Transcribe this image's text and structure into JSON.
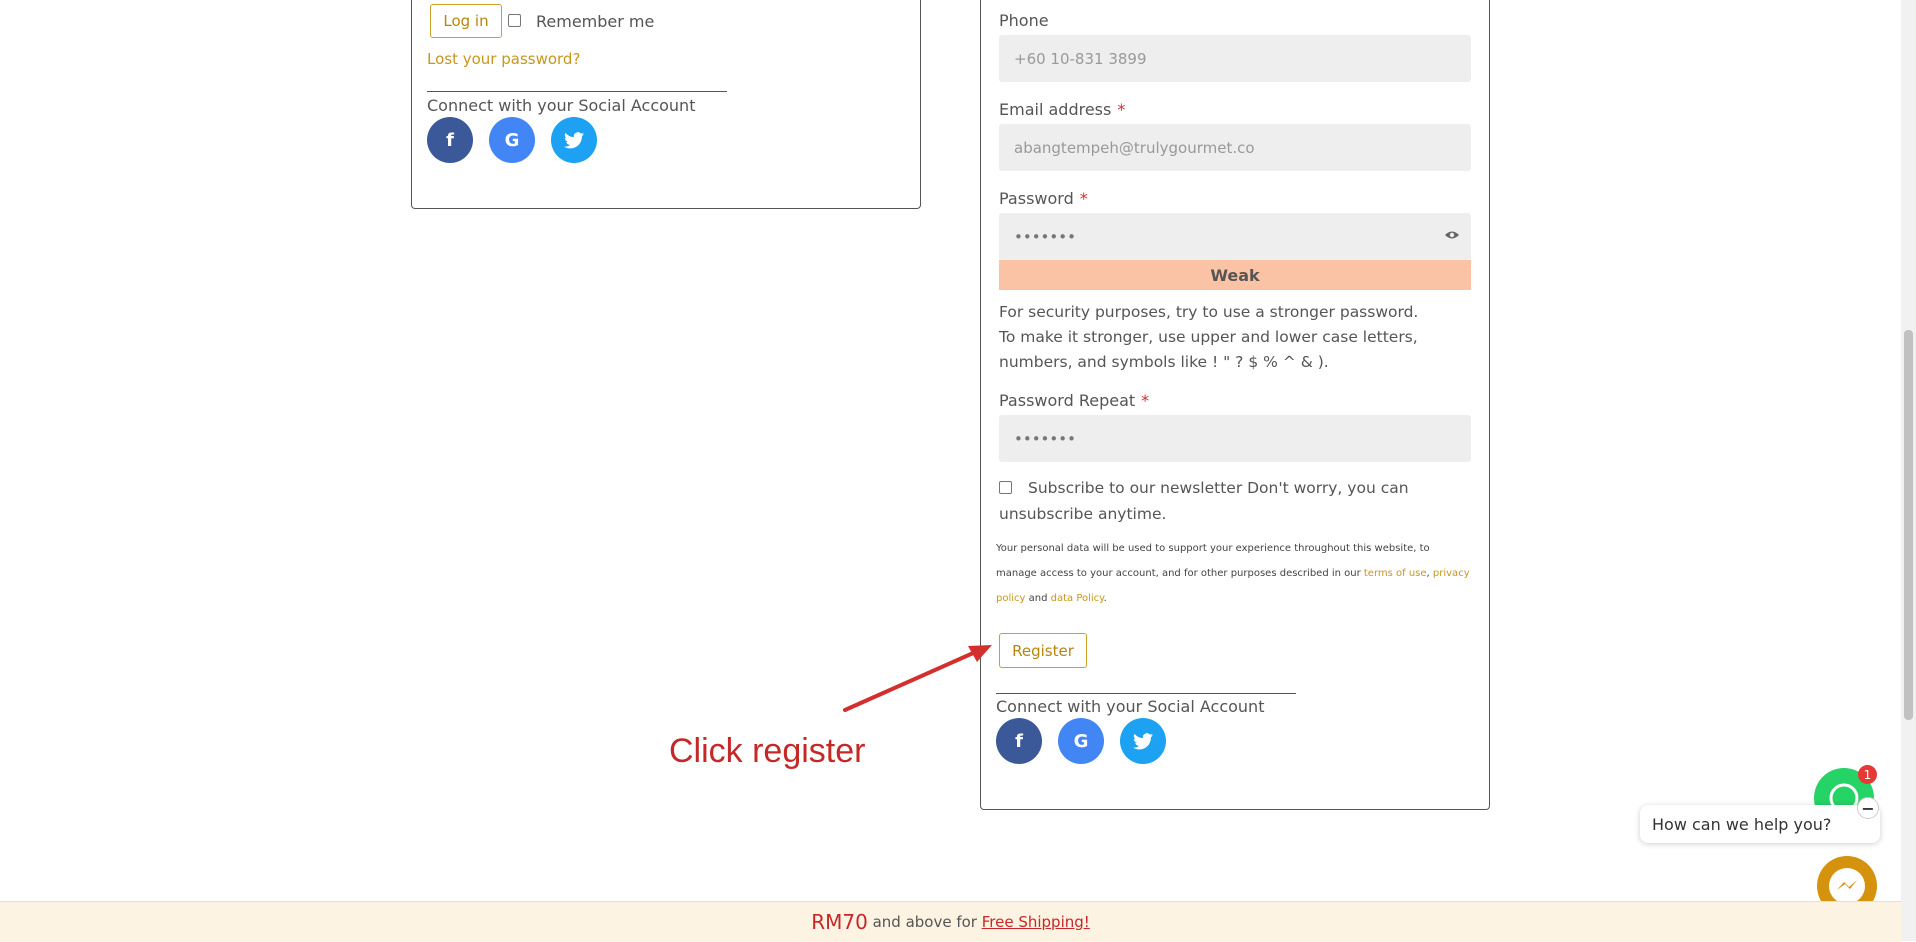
{
  "login": {
    "login_button": "Log in",
    "remember_me": "Remember me",
    "lost_password": "Lost your password?",
    "social_heading": "Connect with your Social Account"
  },
  "register": {
    "phone_label": "Phone",
    "phone_placeholder": "+60 10-831 3899",
    "email_label": "Email address",
    "email_value": "abangtempeh@trulygourmet.co",
    "password_label": "Password",
    "password_value": "•••••••",
    "strength": "Weak",
    "hint_line1": "For security purposes, try to use a stronger password.",
    "hint_line2": "To make it stronger, use upper and lower case letters,",
    "hint_line3": "numbers, and symbols like ! \" ? $ % ^ & ).",
    "password_repeat_label": "Password Repeat",
    "password_repeat_value": "•••••••",
    "required_mark": "*",
    "newsletter_line1": "Subscribe to our newsletter Don't worry, you can",
    "newsletter_line2": "unsubscribe anytime.",
    "privacy_line1": "Your personal data will be used to support your experience throughout this website, to",
    "privacy_line2_pre": "manage access to your account, and for other purposes described in our ",
    "privacy_terms": "terms of use",
    "privacy_comma": ", ",
    "privacy_policy_a": "privacy",
    "privacy_policy_b": "policy",
    "privacy_and": " and ",
    "privacy_data_policy": "data Policy",
    "privacy_end": ".",
    "register_button": "Register",
    "social_heading": "Connect with your Social Account"
  },
  "social": {
    "facebook": "f",
    "google": "G",
    "twitter": "t"
  },
  "annotation": {
    "text": "Click register"
  },
  "chat": {
    "badge": "1",
    "minimize": "−",
    "bubble": "How can we help you?"
  },
  "footer": {
    "price": "RM70",
    "middle": " and above for ",
    "link": "Free Shipping!"
  },
  "colors": {
    "accent_gold": "#c8961e",
    "weak_bar": "#fbc3a6",
    "annotation_red": "#c62828",
    "footer_bg": "#fdf3e3"
  }
}
